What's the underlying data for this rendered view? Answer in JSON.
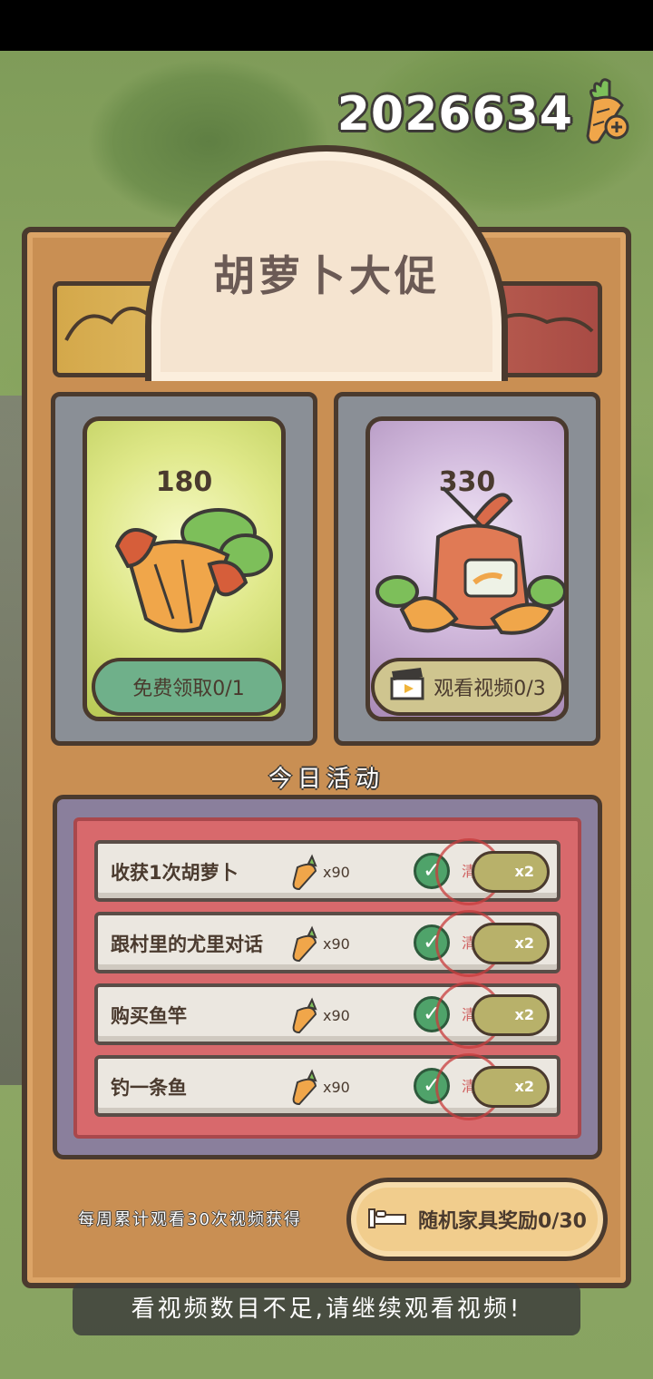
{
  "currency": {
    "value": "2026634",
    "icon": "carrot-plus-icon"
  },
  "title": "胡萝卜大促",
  "deals": [
    {
      "amount": "180",
      "button_label": "免费领取0/1",
      "art": "carrot-bundle-icon",
      "accent": "#dfe889"
    },
    {
      "amount": "330",
      "button_label": "观看视频0/3",
      "art": "carrot-sack-icon",
      "button_icon": "clapperboard-icon",
      "accent": "#d1b9dc"
    }
  ],
  "activities": {
    "title": "今日活动",
    "tasks": [
      {
        "label": "收获1次胡萝卜",
        "reward": "x90",
        "multiplier": "x2"
      },
      {
        "label": "跟村里的尤里对话",
        "reward": "x90",
        "multiplier": "x2"
      },
      {
        "label": "购买鱼竿",
        "reward": "x90",
        "multiplier": "x2"
      },
      {
        "label": "钓一条鱼",
        "reward": "x90",
        "multiplier": "x2"
      }
    ],
    "stamp_text": "清"
  },
  "weekly": {
    "caption": "每周累计观看30次视频获得",
    "button_label": "随机家具奖励0/30",
    "button_icon": "bed-icon"
  },
  "toast": "看视频数目不足,请继续观看视频!"
}
